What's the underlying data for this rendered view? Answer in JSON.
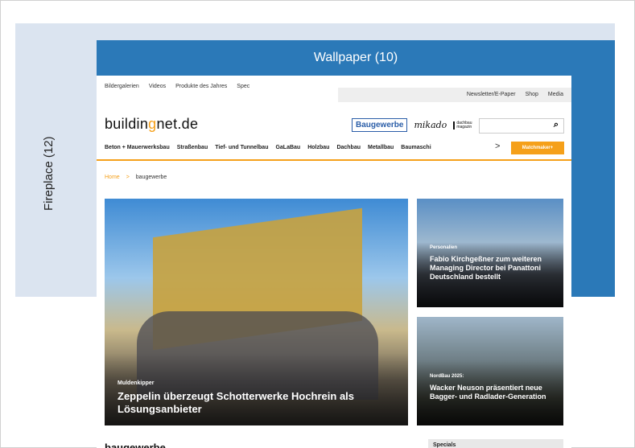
{
  "labels": {
    "fireplace": "Fireplace (12)",
    "wallpaper": "Wallpaper (10)"
  },
  "topbar": {
    "left_links": [
      "Bildergalerien",
      "Videos",
      "Produkte des Jahres",
      "Spec"
    ],
    "right_links": [
      "Newsletter/E-Paper",
      "Shop",
      "Media"
    ]
  },
  "logo": {
    "part1": "buildin",
    "part2": "g",
    "part3": "net.de"
  },
  "brands": {
    "b1": "Baugewerbe",
    "b2": "mikado",
    "b3a": "dachbau",
    "b3b": "magazin"
  },
  "search": {
    "icon": "search-icon",
    "glyph": "⌕"
  },
  "nav": {
    "items": [
      "Beton + Mauerwerksbau",
      "Straßenbau",
      "Tief- und Tunnelbau",
      "GaLaBau",
      "Holzbau",
      "Dachbau",
      "Metallbau",
      "Baumaschi"
    ],
    "arrow": ">",
    "cta": "Matchmaker+"
  },
  "breadcrumb": {
    "home": "Home",
    "sep": ">",
    "current": "baugewerbe"
  },
  "hero": {
    "kicker": "Muldenkipper",
    "title": "Zeppelin überzeugt Schotterwerke Hochrein als Lösungsanbieter"
  },
  "cards": [
    {
      "kicker": "Personalien",
      "title": "Fabio Kirchgeßner zum weiteren Managing Director bei Panattoni Deutschland bestellt"
    },
    {
      "kicker": "NordBau 2025:",
      "title": "Wacker Neuson präsentiert neue Bagger- und Radlader-Generation"
    }
  ],
  "section": {
    "title": "baugewerbe"
  },
  "sidebar": {
    "specials": "Specials"
  },
  "colors": {
    "wallpaper": "#2b79b8",
    "fireplace": "#dbe4f0",
    "accent": "#f5a01a"
  }
}
